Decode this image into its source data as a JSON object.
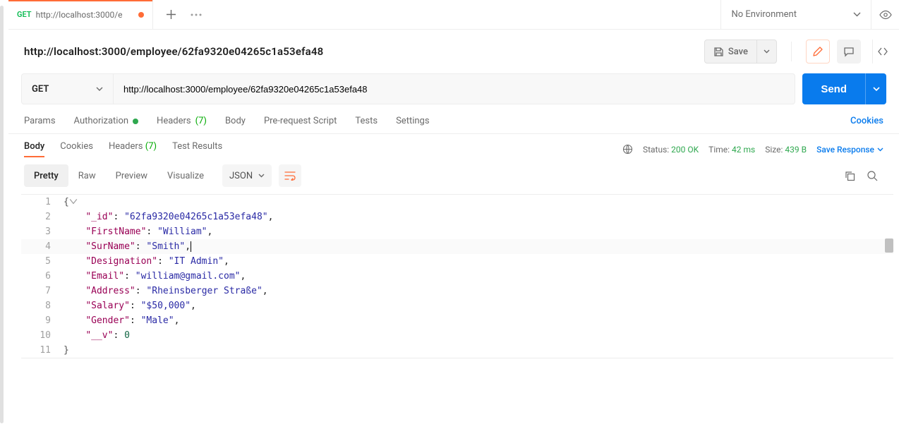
{
  "tab": {
    "method": "GET",
    "title": "http://localhost:3000/e"
  },
  "environment": "No Environment",
  "request": {
    "title": "http://localhost:3000/employee/62fa9320e04265c1a53efa48",
    "save": "Save",
    "method": "GET",
    "url": "http://localhost:3000/employee/62fa9320e04265c1a53efa48",
    "send": "Send"
  },
  "req_tabs": {
    "params": "Params",
    "auth": "Authorization",
    "headers": "Headers",
    "headers_count": "(7)",
    "body": "Body",
    "prescript": "Pre-request Script",
    "tests": "Tests",
    "settings": "Settings",
    "cookies": "Cookies"
  },
  "res_tabs": {
    "body": "Body",
    "cookies": "Cookies",
    "headers": "Headers",
    "headers_count": "(7)",
    "tests": "Test Results"
  },
  "status": {
    "label": "Status:",
    "code": "200 OK",
    "time_label": "Time:",
    "time": "42 ms",
    "size_label": "Size:",
    "size": "439 B",
    "save_response": "Save Response"
  },
  "view": {
    "pretty": "Pretty",
    "raw": "Raw",
    "preview": "Preview",
    "visualize": "Visualize",
    "lang": "JSON"
  },
  "body_json": {
    "l1": "{",
    "l2_k": "\"_id\"",
    "l2_v": "\"62fa9320e04265c1a53efa48\"",
    "l3_k": "\"FirstName\"",
    "l3_v": "\"William\"",
    "l4_k": "\"SurName\"",
    "l4_v": "\"Smith\"",
    "l5_k": "\"Designation\"",
    "l5_v": "\"IT Admin\"",
    "l6_k": "\"Email\"",
    "l6_v": "\"william@gmail.com\"",
    "l7_k": "\"Address\"",
    "l7_v": "\"Rheinsberger Straße\"",
    "l8_k": "\"Salary\"",
    "l8_v": "\"$50,000\"",
    "l9_k": "\"Gender\"",
    "l9_v": "\"Male\"",
    "l10_k": "\"__v\"",
    "l10_v": "0",
    "l11": "}"
  }
}
